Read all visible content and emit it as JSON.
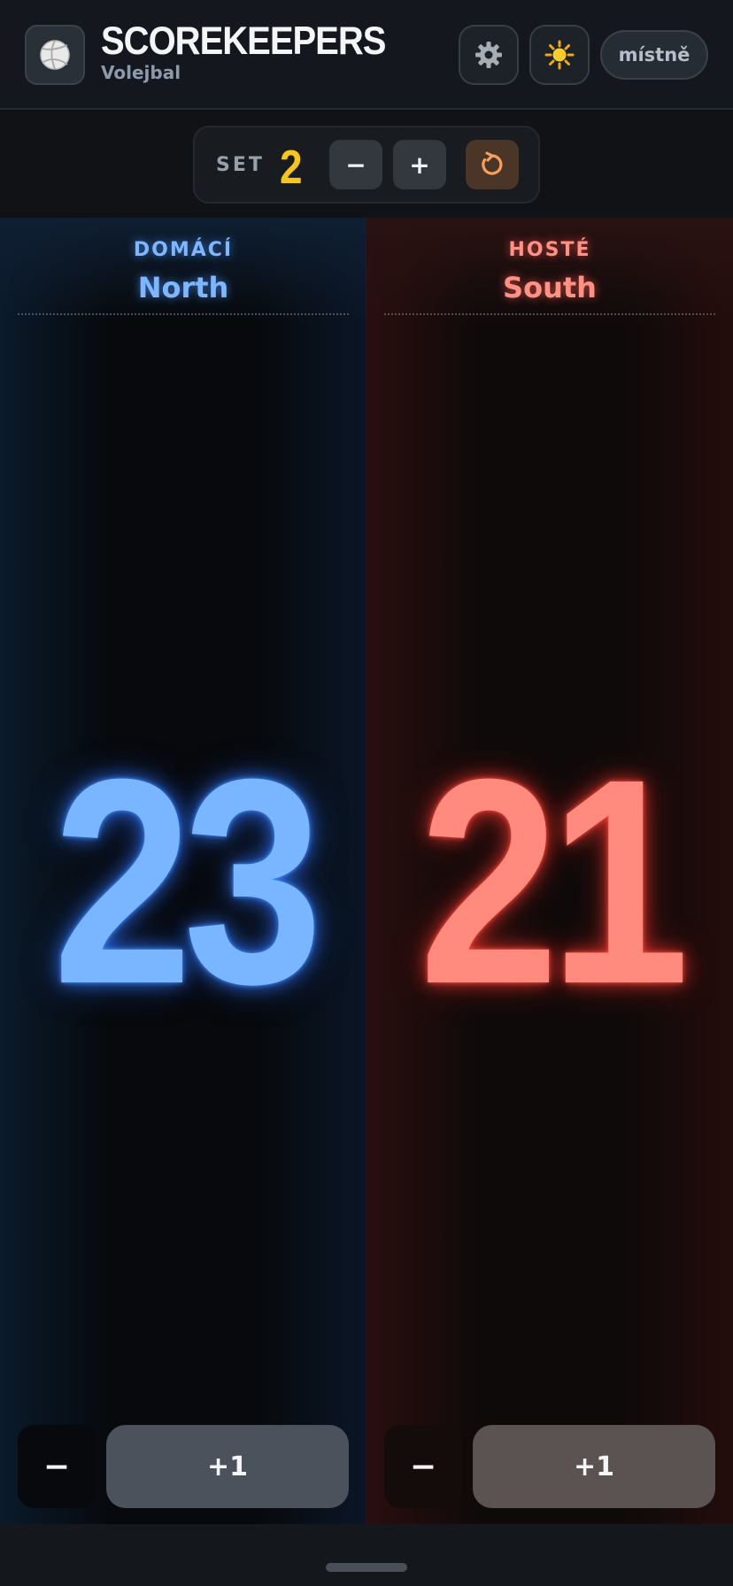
{
  "header": {
    "title": "SCOREKEEPERS",
    "subtitle": "Volejbal",
    "logo_icon": "volleyball-icon",
    "settings_icon": "gear-icon",
    "theme_icon": "sun-icon",
    "language_label": "místně"
  },
  "set_bar": {
    "label": "SET",
    "value": "2",
    "minus_label": "−",
    "plus_label": "+",
    "reset_icon": "reset-icon"
  },
  "home": {
    "side_label": "DOMÁCÍ",
    "team_name": "North",
    "score": "23",
    "minus_label": "−",
    "plus_label": "+1",
    "accent": "#7ab5ff"
  },
  "away": {
    "side_label": "HOSTÉ",
    "team_name": "South",
    "score": "21",
    "minus_label": "−",
    "plus_label": "+1",
    "accent": "#ff8a7d"
  },
  "colors": {
    "set_value": "#f7c51c",
    "background": "#0d0f13"
  }
}
